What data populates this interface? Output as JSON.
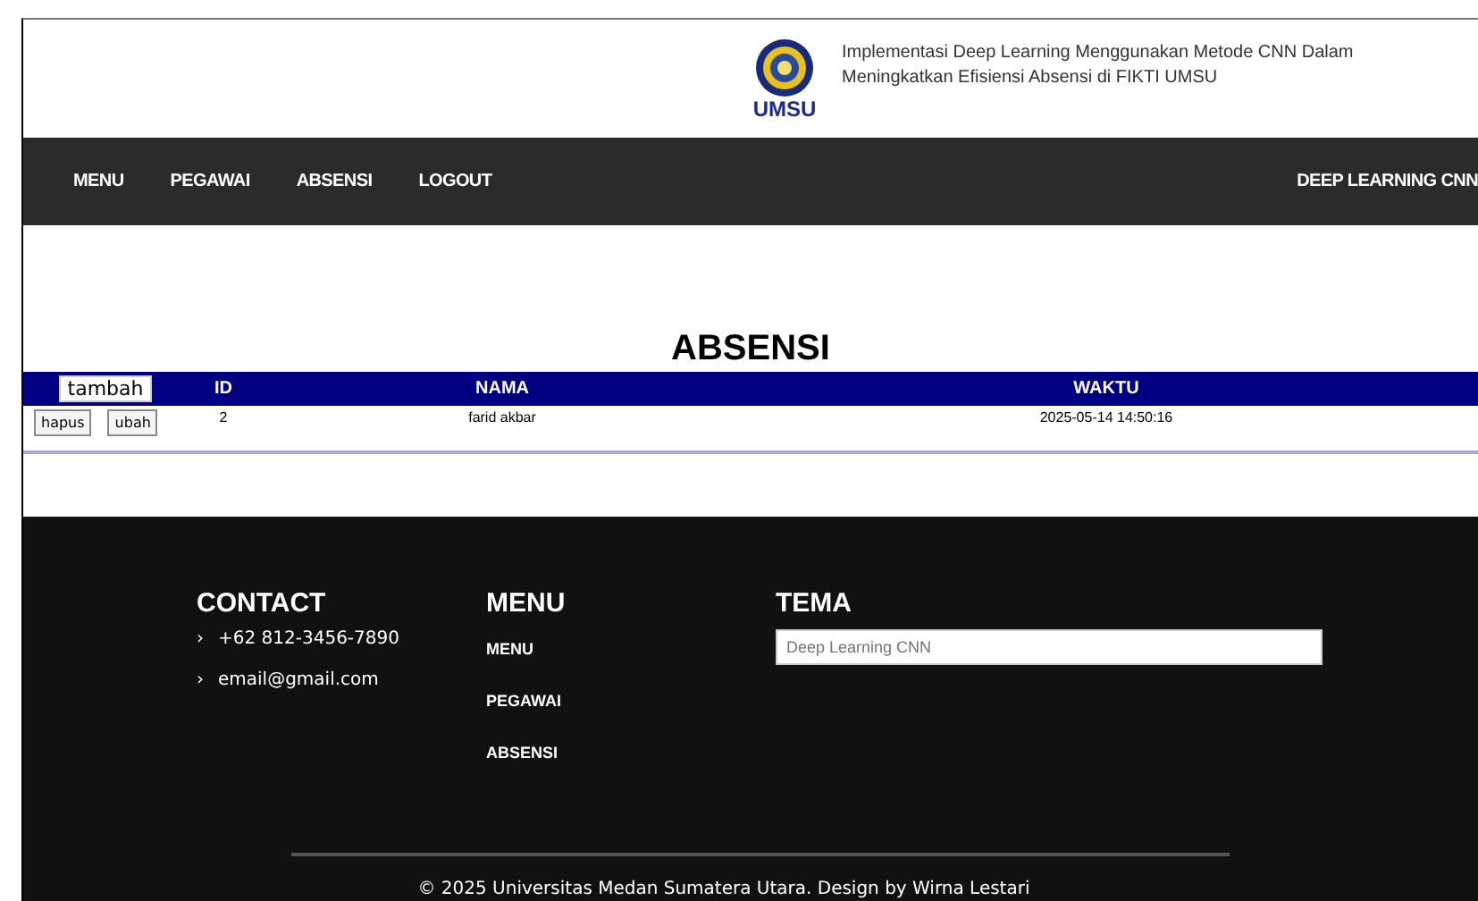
{
  "header": {
    "title_lines": [
      "Implementasi Deep Learning Menggunakan Metode CNN Dalam",
      "Meningkatkan Efisiensi Absensi di FIKTI UMSU"
    ],
    "logo_text": "UMSU"
  },
  "nav": {
    "items": [
      "MENU",
      "PEGAWAI",
      "ABSENSI",
      "LOGOUT"
    ],
    "brand": "DEEP LEARNING CNN"
  },
  "page_title": "ABSENSI",
  "table": {
    "add_button": "tambah",
    "columns": [
      "ID",
      "NAMA",
      "WAKTU"
    ],
    "rows": [
      {
        "actions": [
          "hapus",
          "ubah"
        ],
        "cells": [
          "2",
          "farid akbar",
          "2025-05-14 14:50:16"
        ]
      }
    ]
  },
  "footer": {
    "contact": {
      "heading": "CONTACT",
      "items": [
        "+62 812-3456-7890",
        "email@gmail.com"
      ],
      "bullet": "›"
    },
    "menu": {
      "heading": "MENU",
      "items": [
        "MENU",
        "PEGAWAI",
        "ABSENSI"
      ]
    },
    "tema": {
      "heading": "TEMA",
      "placeholder": "Deep Learning CNN"
    },
    "copyright": "© 2025 Universitas Medan Sumatera Utara. Design by Wirna Lestari"
  }
}
